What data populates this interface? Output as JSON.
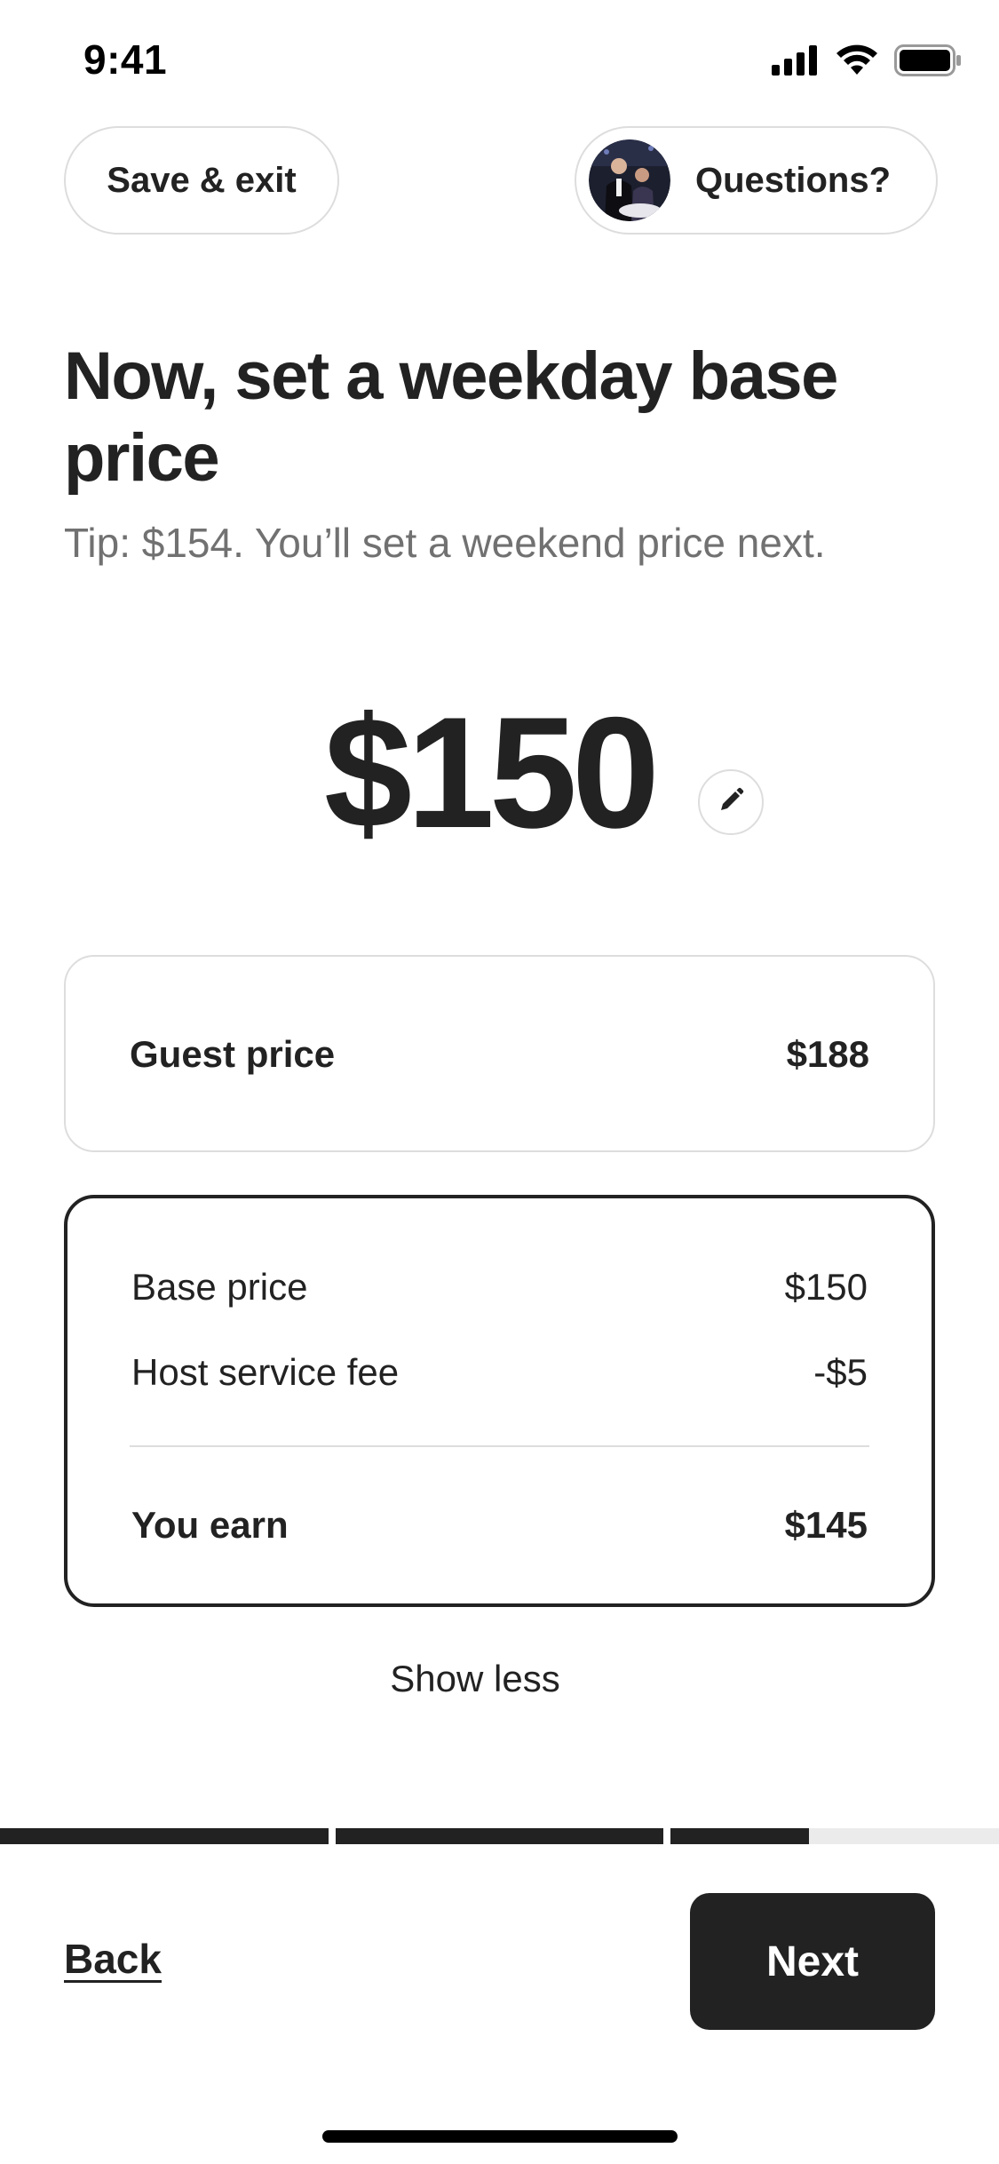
{
  "status_bar": {
    "time": "9:41",
    "icons": [
      "cellular-signal-icon",
      "wifi-icon",
      "battery-icon"
    ]
  },
  "header": {
    "save_exit_label": "Save & exit",
    "questions_label": "Questions?"
  },
  "main": {
    "title": "Now, set a weekday base price",
    "subtitle": "Tip: $154. You’ll set a weekend price next.",
    "price": "$150",
    "edit_icon": "pencil-icon"
  },
  "guest_card": {
    "label": "Guest price",
    "value": "$188"
  },
  "breakdown_card": {
    "rows": [
      {
        "label": "Base price",
        "value": "$150"
      },
      {
        "label": "Host service fee",
        "value": "-$5"
      }
    ],
    "total": {
      "label": "You earn",
      "value": "$145"
    }
  },
  "show_less_label": "Show less",
  "progress": {
    "segments": [
      1.0,
      1.0,
      0.42
    ]
  },
  "footer": {
    "back_label": "Back",
    "next_label": "Next"
  },
  "colors": {
    "text": "#222222",
    "muted": "#717171",
    "border": "#dddddd",
    "progress_track": "#ebebeb",
    "button_bg": "#222222"
  }
}
